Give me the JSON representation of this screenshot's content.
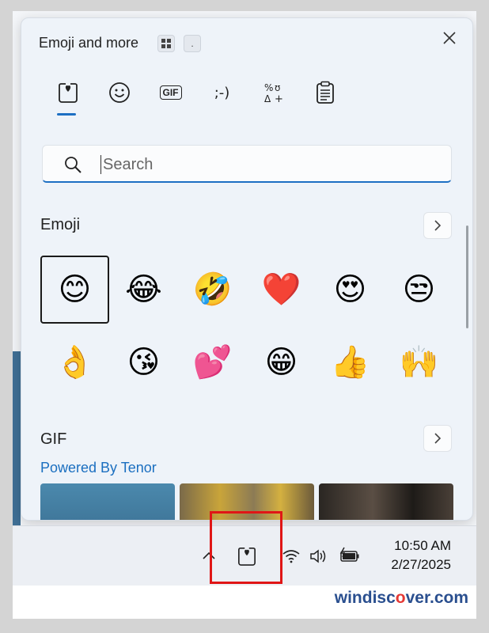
{
  "panel": {
    "title": "Emoji and more",
    "dot_button": ".",
    "tabs": [
      {
        "label": "Favorites",
        "icon": "heart-in-box-icon",
        "active": true
      },
      {
        "label": "Emoji",
        "icon": "smiley-icon"
      },
      {
        "label": "GIF",
        "icon": "gif-icon"
      },
      {
        "label": ";-)",
        "icon": "kaomoji-icon"
      },
      {
        "label": "Symbols",
        "icon": "symbols-icon"
      },
      {
        "label": "Clipboard",
        "icon": "clipboard-icon"
      }
    ],
    "tab_text": {
      "gif": "GIF",
      "kaomoji": ";-)"
    }
  },
  "search": {
    "placeholder": "Search",
    "value": ""
  },
  "emoji_section": {
    "title": "Emoji",
    "items": [
      {
        "name": "smiling-face",
        "glyph": "😊"
      },
      {
        "name": "face-with-tears-of-joy",
        "glyph": "😂"
      },
      {
        "name": "rolling-on-floor-laughing",
        "glyph": "🤣"
      },
      {
        "name": "red-heart",
        "glyph": "❤️"
      },
      {
        "name": "heart-eyes",
        "glyph": "😍"
      },
      {
        "name": "disappointed-face",
        "glyph": "😒"
      },
      {
        "name": "ok-hand",
        "glyph": "👌"
      },
      {
        "name": "face-blowing-kiss",
        "glyph": "😘"
      },
      {
        "name": "two-hearts",
        "glyph": "💕"
      },
      {
        "name": "grinning-face",
        "glyph": "😁"
      },
      {
        "name": "thumbs-up",
        "glyph": "👍"
      },
      {
        "name": "raising-hands",
        "glyph": "🙌"
      }
    ],
    "selected_index": 0
  },
  "gif_section": {
    "title": "GIF",
    "subtitle": "Powered By Tenor"
  },
  "taskbar": {
    "time": "10:50 AM",
    "date": "2/27/2025",
    "icons": [
      "chevron-up-icon",
      "emoji-panel-icon",
      "wifi-icon",
      "volume-icon",
      "battery-charging-icon"
    ]
  },
  "watermark": {
    "part1": "windisc",
    "o": "o",
    "part2": "ver.com"
  },
  "colors": {
    "accent": "#1d6fc3",
    "highlight": "#e01616",
    "link": "#1b6fc0"
  }
}
